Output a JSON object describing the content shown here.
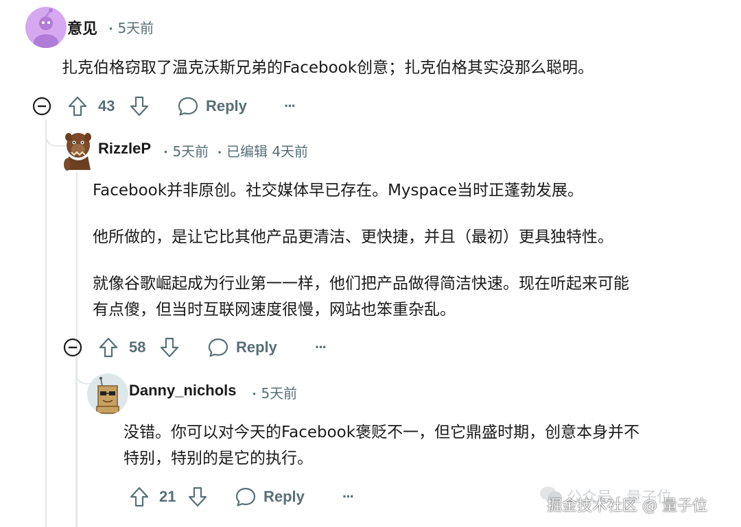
{
  "comments": [
    {
      "author": "意见",
      "time": "5天前",
      "edited": "",
      "body": [
        "扎克伯格窃取了温克沃斯兄弟的Facebook创意；扎克伯格其实没那么聪明。"
      ],
      "votes": "43",
      "reply_label": "Reply",
      "more_label": "···"
    },
    {
      "author": "RizzleP",
      "time": "5天前",
      "edited": "已编辑 4天前",
      "body": [
        "Facebook并非原创。社交媒体早已存在。Myspace当时正蓬勃发展。",
        "他所做的，是让它比其他产品更清洁、更快捷，并且（最初）更具独特性。",
        "就像谷歌崛起成为行业第一一样，他们把产品做得简洁快速。现在听起来可能",
        "有点傻，但当时互联网速度很慢，网站也笨重杂乱。"
      ],
      "votes": "58",
      "reply_label": "Reply",
      "more_label": "···"
    },
    {
      "author": "Danny_nichols",
      "time": "5天前",
      "edited": "",
      "body": [
        "没错。你可以对今天的Facebook褒贬不一，但它鼎盛时期，创意本身并不",
        "特别，特别的是它的执行。"
      ],
      "votes": "21",
      "reply_label": "Reply",
      "more_label": "···"
    }
  ],
  "separator": "•",
  "watermark": {
    "faint": "公众号 · 量子位",
    "main": "掘金技术社区 @ 量子位"
  },
  "colors": {
    "text": "#1a1a1b",
    "meta": "#576f76",
    "thread_line": "#e5e8ea",
    "avatar_purple": "#d6a8f0"
  }
}
